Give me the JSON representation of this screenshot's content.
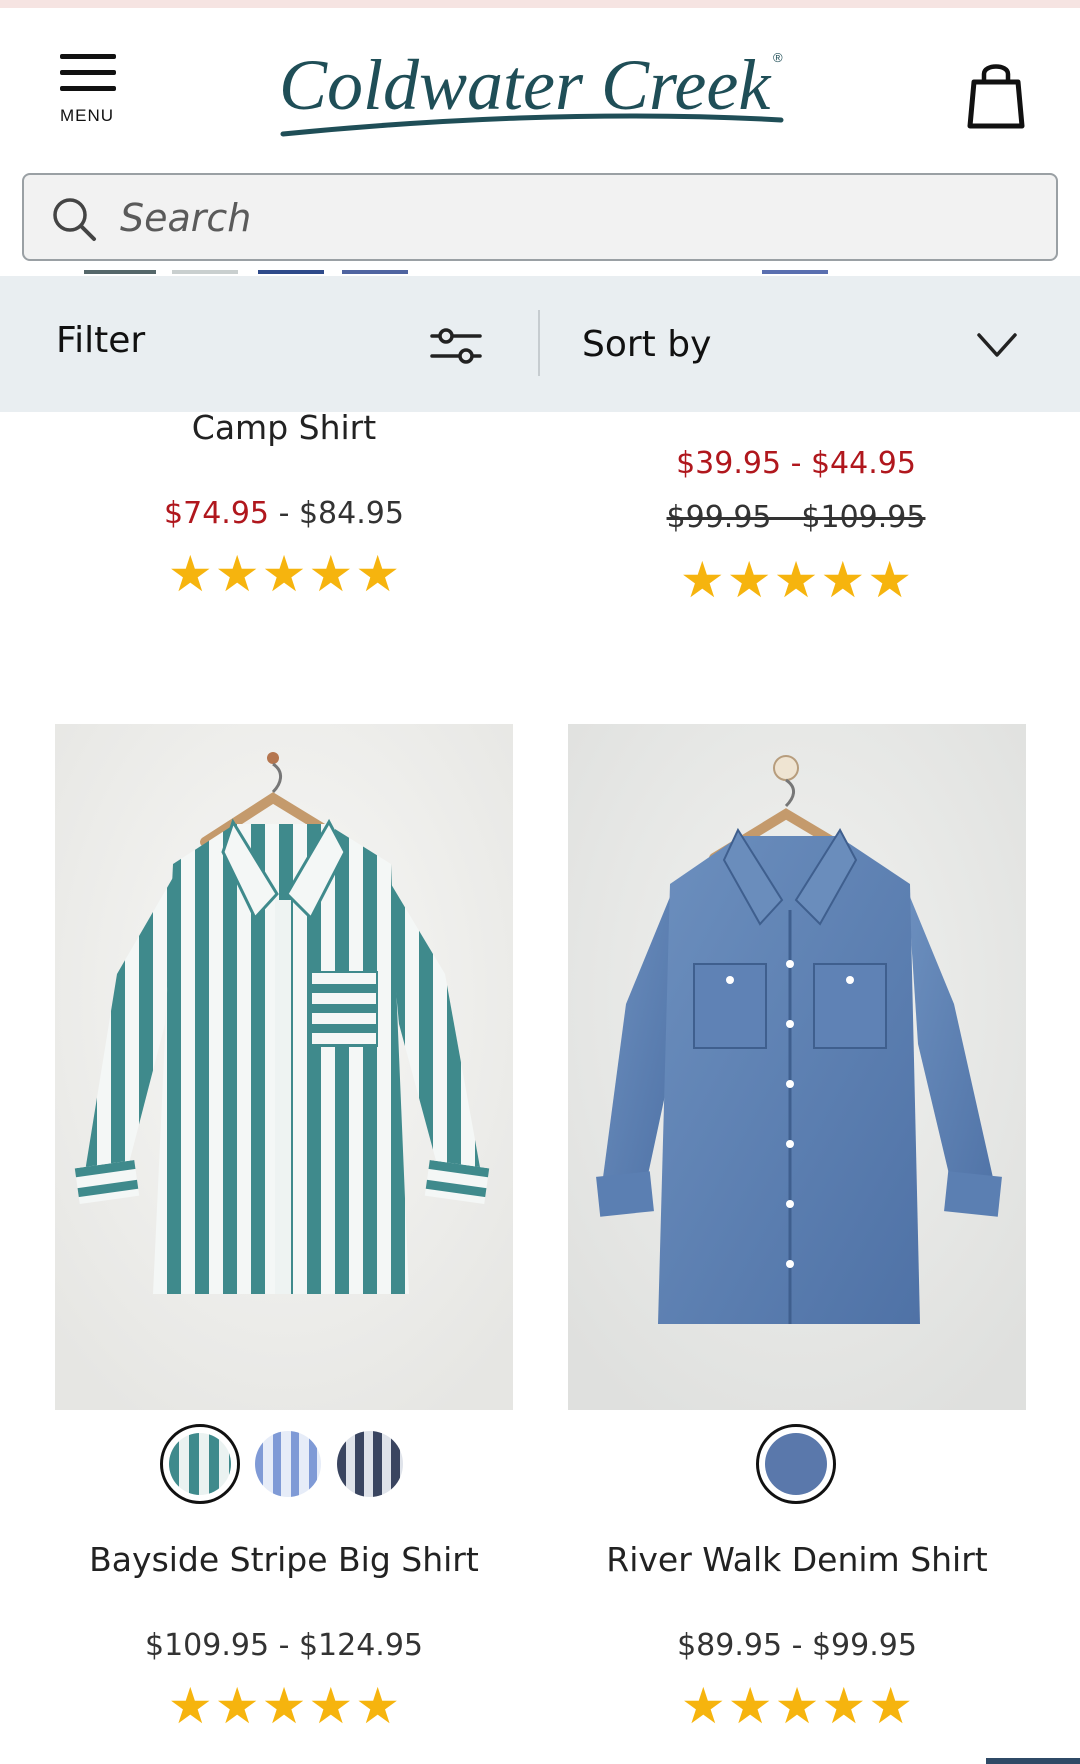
{
  "header": {
    "menu_label": "MENU",
    "logo_text": "Coldwater Creek",
    "logo_reg": "®",
    "logo_color": "#1f4e57"
  },
  "search": {
    "placeholder": "Search",
    "value": ""
  },
  "toolbar": {
    "filter_label": "Filter",
    "sort_label": "Sort by"
  },
  "colors": {
    "sale_price": "#b0171d",
    "star": "#f6b40e",
    "toolbar_bg": "#e9eef1"
  },
  "previous_products": [
    {
      "name": "Camp Shirt",
      "sale_price": "$74.95",
      "separator": "-",
      "regular_price": "$84.95",
      "rating": 5
    },
    {
      "sale_price": "$39.95 - $44.95",
      "original_price": "$99.95 - $109.95",
      "rating": 5
    }
  ],
  "products": [
    {
      "name": "Bayside Stripe Big Shirt",
      "price": "$109.95 - $124.95",
      "rating": 5,
      "swatches": [
        "teal-stripe",
        "blue-stripe",
        "navy-stripe"
      ],
      "selected_swatch": 0
    },
    {
      "name": "River Walk Denim Shirt",
      "price": "$89.95 - $99.95",
      "rating": 5,
      "swatches": [
        "denim"
      ],
      "selected_swatch": 0
    }
  ]
}
